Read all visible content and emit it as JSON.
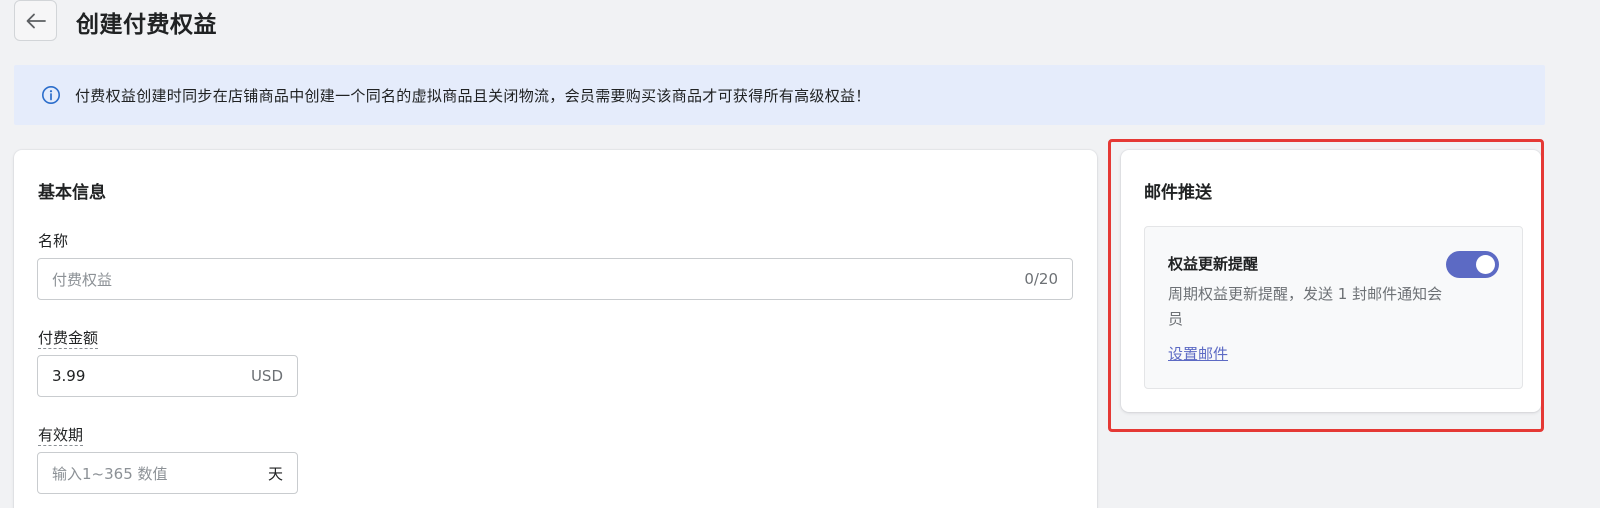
{
  "header": {
    "title": "创建付费权益",
    "back_icon": "arrow-left-icon"
  },
  "banner": {
    "icon": "info-icon",
    "text": "付费权益创建时同步在店铺商品中创建一个同名的虚拟商品且关闭物流，会员需要购买该商品才可获得所有高级权益！"
  },
  "basic_info": {
    "title": "基本信息",
    "name_field": {
      "label": "名称",
      "placeholder": "付费权益",
      "counter": "0/20"
    },
    "price_field": {
      "label": "付费金额",
      "value": "3.99",
      "suffix": "USD"
    },
    "validity_field": {
      "label": "有效期",
      "placeholder": "输入1~365 数值",
      "suffix": "天"
    }
  },
  "email_push": {
    "title": "邮件推送",
    "reminder": {
      "title": "权益更新提醒",
      "description": "周期权益更新提醒，发送 1 封邮件通知会员",
      "link": "设置邮件",
      "enabled": true
    }
  },
  "colors": {
    "accent": "#5c6ac4",
    "banner_bg": "#e5ecfb",
    "highlight": "#e53935",
    "page_bg": "#f1f2f4"
  }
}
